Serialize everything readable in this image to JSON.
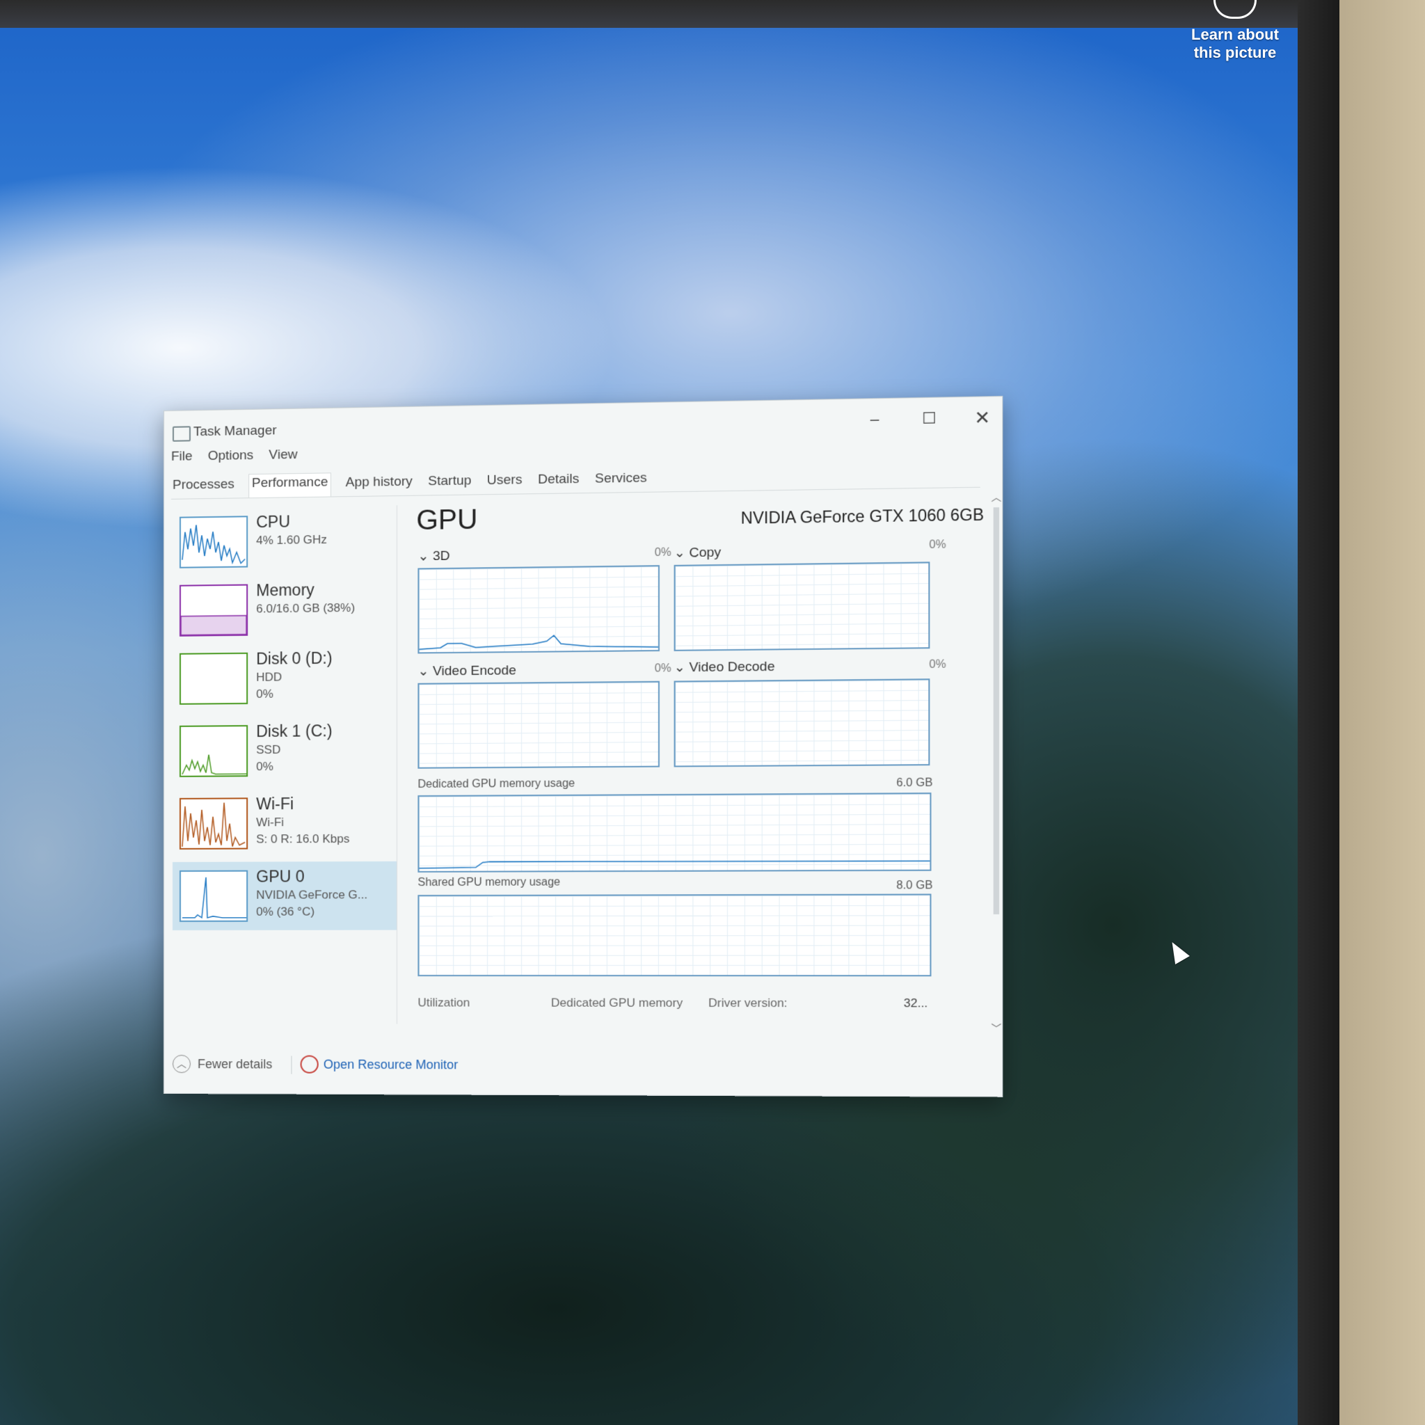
{
  "desktop": {
    "learn_about": "Learn about this picture"
  },
  "window": {
    "title": "Task Manager",
    "menu": [
      "File",
      "Options",
      "View"
    ],
    "tabs": [
      "Processes",
      "Performance",
      "App history",
      "Startup",
      "Users",
      "Details",
      "Services"
    ],
    "active_tab": "Performance"
  },
  "sidebar": {
    "items": [
      {
        "name": "CPU",
        "line1": "4% 1.60 GHz",
        "line2": "",
        "color": "#1d77c2"
      },
      {
        "name": "Memory",
        "line1": "6.0/16.0 GB (38%)",
        "line2": "",
        "color": "#8b2fa8"
      },
      {
        "name": "Disk 0 (D:)",
        "line1": "HDD",
        "line2": "0%",
        "color": "#4a9a22"
      },
      {
        "name": "Disk 1 (C:)",
        "line1": "SSD",
        "line2": "0%",
        "color": "#4a9a22"
      },
      {
        "name": "Wi-Fi",
        "line1": "Wi-Fi",
        "line2": "S: 0 R: 16.0 Kbps",
        "color": "#b0561b"
      },
      {
        "name": "GPU 0",
        "line1": "NVIDIA GeForce G...",
        "line2": "0% (36 °C)",
        "color": "#1d77c2",
        "selected": true
      }
    ]
  },
  "gpu": {
    "heading": "GPU",
    "model": "NVIDIA GeForce GTX 1060 6GB",
    "engines": [
      {
        "label": "3D",
        "pct": "0%"
      },
      {
        "label": "Copy",
        "pct": "0%"
      },
      {
        "label": "Video Encode",
        "pct": "0%"
      },
      {
        "label": "Video Decode",
        "pct": "0%"
      }
    ],
    "dedicated_label": "Dedicated GPU memory usage",
    "dedicated_max": "6.0 GB",
    "shared_label": "Shared GPU memory usage",
    "shared_max": "8.0 GB",
    "stats": {
      "utilization": "Utilization",
      "dedicated_memory": "Dedicated GPU memory",
      "driver_version": "Driver version:",
      "driver_value": "32..."
    }
  },
  "footer": {
    "fewer_details": "Fewer details",
    "open_resource_monitor": "Open Resource Monitor"
  }
}
